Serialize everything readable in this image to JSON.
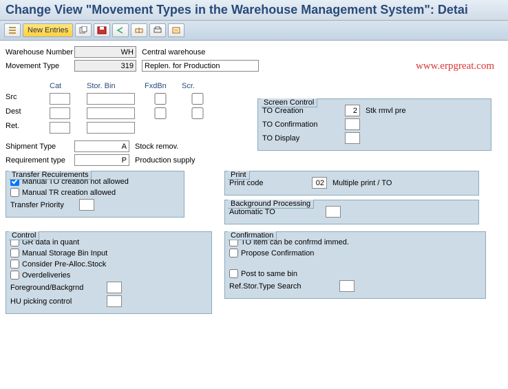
{
  "title": "Change View \"Movement Types in the Warehouse Management System\": Detai",
  "toolbar": {
    "newEntries": "New Entries"
  },
  "watermark": "www.erpgreat.com",
  "header": {
    "whNumLabel": "Warehouse Number",
    "whNum": "WH",
    "whDesc": "Central warehouse",
    "mvTypeLabel": "Movement Type",
    "mvType": "319",
    "mvDesc": "Replen. for Production"
  },
  "gridHdr": {
    "cat": "Cat",
    "stor": "Stor. Bin",
    "fxdbn": "FxdBn",
    "scr": "Scr."
  },
  "gridRows": {
    "src": "Src",
    "dest": "Dest",
    "ret": "Ret."
  },
  "ship": {
    "shipTypeLabel": "Shipment Type",
    "shipType": "A",
    "shipDesc": "Stock remov.",
    "reqTypeLabel": "Requirement type",
    "reqType": "P",
    "reqDesc": "Production supply"
  },
  "screenCtrl": {
    "title": "Screen Control",
    "toCreateLabel": "TO Creation",
    "toCreateVal": "2",
    "toCreateDesc": "Stk rmvl pre",
    "toConfLabel": "TO Confirmation",
    "toDispLabel": "TO Display"
  },
  "transfer": {
    "title": "Transfer Recuirements",
    "manualTO": "Manual TO creation not allowed",
    "manualTR": "Manual TR creation allowed",
    "prioLabel": "Transfer Priority"
  },
  "print": {
    "title": "Print",
    "codeLabel": "Print code",
    "codeVal": "02",
    "codeDesc": "Multiple print / TO"
  },
  "bg": {
    "title": "Background Processing",
    "autoLabel": "Automatic TO"
  },
  "control": {
    "title": "Control",
    "gr": "GR data in quant",
    "manStor": "Manual Storage Bin Input",
    "preAlloc": "Consider Pre-Alloc.Stock",
    "over": "Overdeliveries",
    "fgbg": "Foreground/Backgrnd",
    "hu": "HU picking control"
  },
  "confirm": {
    "title": "Confirmation",
    "toItem": "TO item can be confrmd immed.",
    "propose": "Propose Confirmation",
    "postSame": "Post to same bin",
    "refStor": "Ref.Stor.Type Search"
  }
}
